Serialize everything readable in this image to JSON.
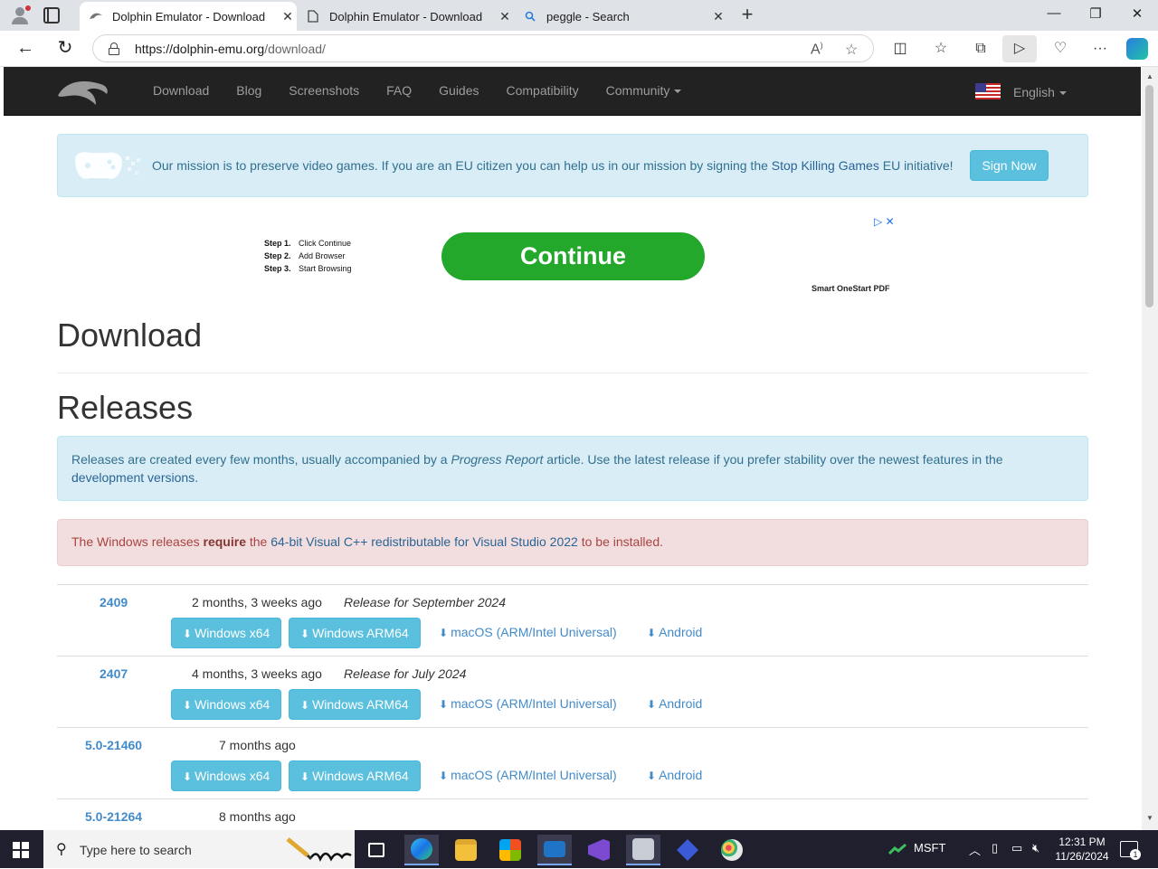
{
  "browser": {
    "tabs": [
      {
        "title": "Dolphin Emulator - Download",
        "active": true
      },
      {
        "title": "Dolphin Emulator - Download",
        "active": false
      },
      {
        "title": "peggle - Search",
        "active": false
      }
    ],
    "url_host": "https://dolphin-emu.org",
    "url_path": "/download/"
  },
  "site_nav": {
    "links": [
      "Download",
      "Blog",
      "Screenshots",
      "FAQ",
      "Guides",
      "Compatibility"
    ],
    "community": "Community",
    "language": "English"
  },
  "mission": {
    "text_before": "Our mission is to preserve video games. If you are an EU citizen you can help us in our mission by signing the ",
    "link": "Stop Killing Games",
    "text_after": " EU initiative!",
    "button": "Sign Now"
  },
  "ad": {
    "steps": [
      {
        "n": "Step 1.",
        "t": "Click Continue"
      },
      {
        "n": "Step 2.",
        "t": "Add Browser"
      },
      {
        "n": "Step 3.",
        "t": "Start Browsing"
      }
    ],
    "button": "Continue",
    "brand": "Smart OneStart PDF"
  },
  "page": {
    "title": "Download",
    "releases_heading": "Releases",
    "info_before": "Releases are created every few months, usually accompanied by a ",
    "info_em": "Progress Report",
    "info_mid": " article. Use the latest release if you prefer stability over the newest features in the ",
    "info_link": "development versions",
    "info_after": ".",
    "danger_before": "The Windows releases ",
    "danger_bold": "require",
    "danger_mid": " the ",
    "danger_link": "64-bit Visual C++ redistributable for Visual Studio 2022",
    "danger_after": " to be installed."
  },
  "download_labels": {
    "win64": "Windows x64",
    "arm64": "Windows ARM64",
    "mac": "macOS (ARM/Intel Universal)",
    "android": "Android"
  },
  "releases": [
    {
      "version": "2409",
      "age": "2 months, 3 weeks ago",
      "desc": "Release for September 2024"
    },
    {
      "version": "2407",
      "age": "4 months, 3 weeks ago",
      "desc": "Release for July 2024"
    },
    {
      "version": "5.0-21460",
      "age": "7 months ago",
      "desc": ""
    },
    {
      "version": "5.0-21264",
      "age": "8 months ago",
      "desc": ""
    }
  ],
  "taskbar": {
    "search_placeholder": "Type here to search",
    "stock": "MSFT",
    "time": "12:31 PM",
    "date": "11/26/2024",
    "notifications": "1"
  }
}
